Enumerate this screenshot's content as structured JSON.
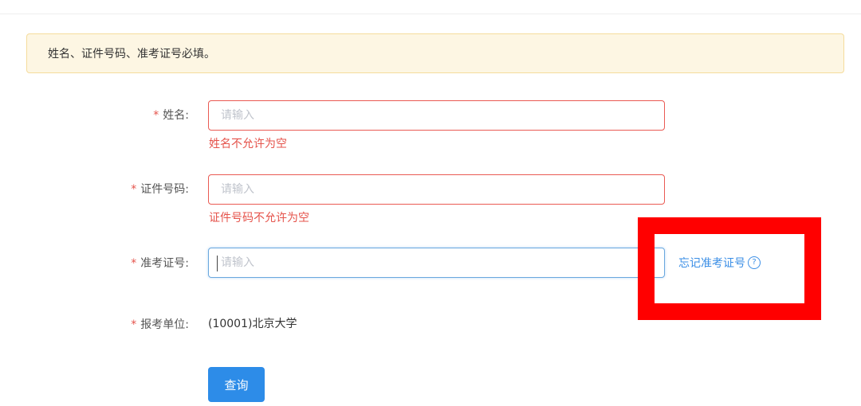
{
  "notice": {
    "text": "姓名、证件号码、准考证号必填。"
  },
  "form": {
    "required_mark": "*",
    "name": {
      "label": "姓名:",
      "placeholder": "请输入",
      "value": "",
      "error": "姓名不允许为空"
    },
    "id_number": {
      "label": "证件号码:",
      "placeholder": "请输入",
      "value": "",
      "error": "证件号码不允许为空"
    },
    "exam_number": {
      "label": "准考证号:",
      "placeholder": "请输入",
      "value": "",
      "forgot_link": "忘记准考证号"
    },
    "unit": {
      "label": "报考单位:",
      "value": "(10001)北京大学"
    },
    "submit_label": "查询"
  },
  "icons": {
    "help": "question-circle-icon"
  },
  "colors": {
    "error": "#e5534b",
    "link": "#3a8ee6",
    "primary_button": "#2d8ce8",
    "notice_bg": "#fdf6e3",
    "highlight": "#ff0000"
  }
}
